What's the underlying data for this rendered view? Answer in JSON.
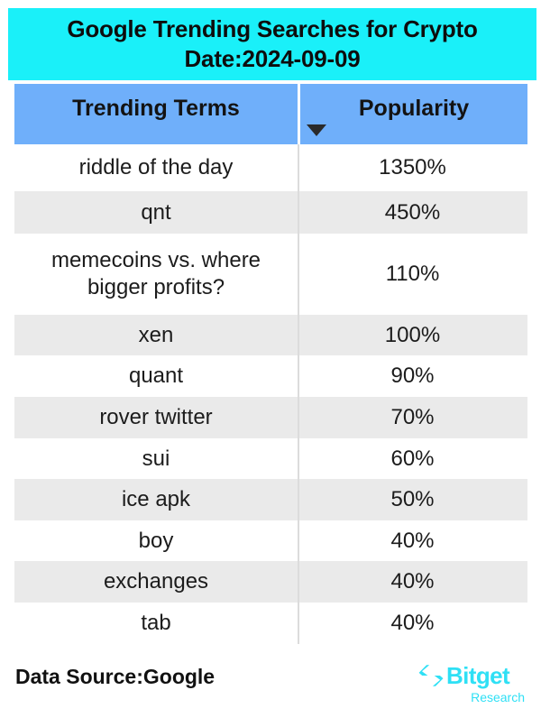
{
  "banner": {
    "line1": "Google Trending Searches for Crypto",
    "line2": "Date:2024-09-09",
    "background_color": "#1AF0F9",
    "text_color": "#0D0D0D"
  },
  "table": {
    "header_background_color": "#6FAFFA",
    "alt_row_color": "#EAEAEA",
    "columns": [
      {
        "label": "Trending Terms"
      },
      {
        "label": "Popularity",
        "sort_indicator": "sort-desc-triangle"
      }
    ],
    "rows": [
      {
        "term": "riddle of the day",
        "popularity": "1350%"
      },
      {
        "term": "qnt",
        "popularity": "450%"
      },
      {
        "term": "memecoins vs. where bigger profits?",
        "popularity": "110%"
      },
      {
        "term": "xen",
        "popularity": "100%"
      },
      {
        "term": "quant",
        "popularity": "90%"
      },
      {
        "term": "rover twitter",
        "popularity": "70%"
      },
      {
        "term": "sui",
        "popularity": "60%"
      },
      {
        "term": "ice apk",
        "popularity": "50%"
      },
      {
        "term": "boy",
        "popularity": "40%"
      },
      {
        "term": "exchanges",
        "popularity": "40%"
      },
      {
        "term": "tab",
        "popularity": "40%"
      }
    ]
  },
  "footer": {
    "data_source": "Data Source:Google",
    "logo": {
      "wordmark": "Bitget",
      "subtitle": "Research",
      "color": "#2FE0F5"
    }
  },
  "chart_data": {
    "type": "table",
    "title": "Google Trending Searches for Crypto Date:2024-09-09",
    "columns": [
      "Trending Terms",
      "Popularity"
    ],
    "categories": [
      "riddle of the day",
      "qnt",
      "memecoins vs. where bigger profits?",
      "xen",
      "quant",
      "rover twitter",
      "sui",
      "ice apk",
      "boy",
      "exchanges",
      "tab"
    ],
    "values": [
      1350,
      450,
      110,
      100,
      90,
      70,
      60,
      50,
      40,
      40,
      40
    ],
    "value_labels": [
      "1350%",
      "450%",
      "110%",
      "100%",
      "90%",
      "70%",
      "60%",
      "50%",
      "40%",
      "40%",
      "40%"
    ],
    "xlabel": "Trending Terms",
    "ylabel": "Popularity",
    "unit": "%",
    "sorted_by": "Popularity",
    "sort_order": "descending",
    "source": "Data Source:Google"
  }
}
